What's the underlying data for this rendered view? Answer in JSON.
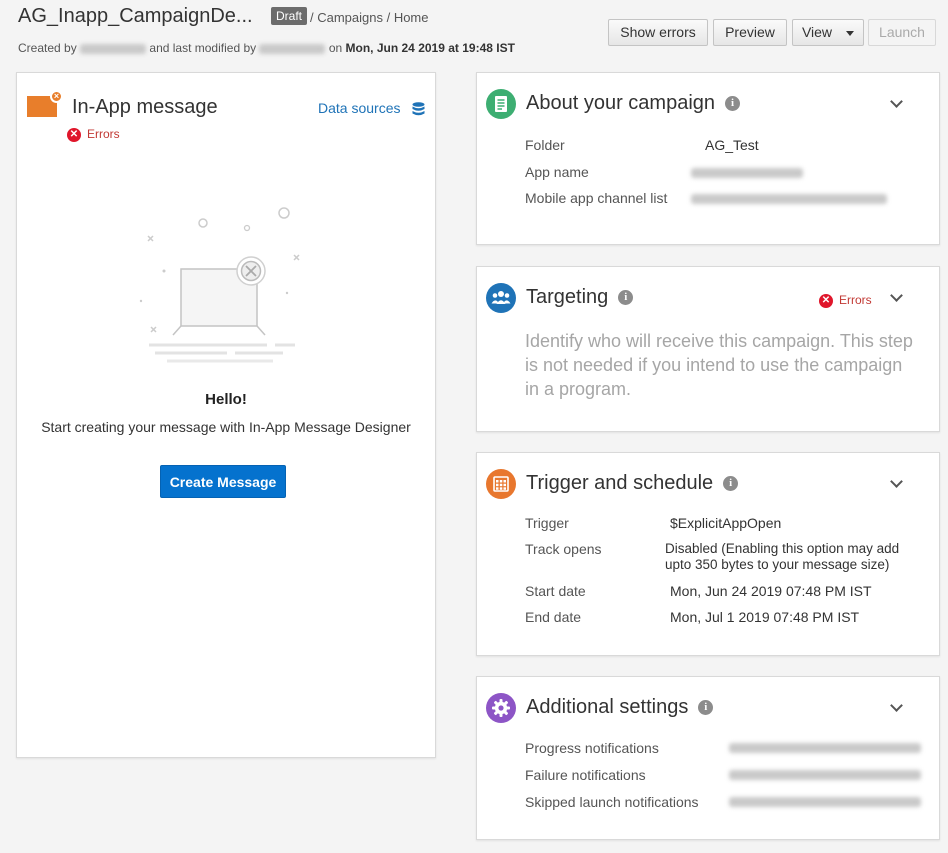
{
  "header": {
    "title": "AG_Inapp_CampaignDe...",
    "status_badge": "Draft",
    "breadcrumb": "/ Campaigns / Home",
    "created_by_label": "Created by",
    "modified_label": "and last modified by",
    "on_label": "on",
    "modified_date": "Mon, Jun 24 2019 at 19:48 IST"
  },
  "toolbar": {
    "show_errors": "Show errors",
    "preview": "Preview",
    "view": "View",
    "launch": "Launch"
  },
  "message_panel": {
    "title": "In-App message",
    "data_sources": "Data sources",
    "errors": "Errors",
    "hello": "Hello!",
    "subtitle": "Start creating your message with In-App Message Designer",
    "create_button": "Create Message"
  },
  "about": {
    "title": "About your campaign",
    "folder_label": "Folder",
    "folder_value": "AG_Test",
    "app_name_label": "App name",
    "channel_label": "Mobile app channel list"
  },
  "targeting": {
    "title": "Targeting",
    "errors": "Errors",
    "description": "Identify who will receive this campaign. This step is not needed if you intend to use the campaign in a program."
  },
  "trigger": {
    "title": "Trigger and schedule",
    "trigger_label": "Trigger",
    "trigger_value": "$ExplicitAppOpen",
    "track_label": "Track opens",
    "track_value": "Disabled (Enabling this option may add upto 350 bytes to your message size)",
    "start_label": "Start date",
    "start_value": "Mon, Jun 24 2019 07:48 PM IST",
    "end_label": "End date",
    "end_value": "Mon, Jul 1 2019 07:48 PM IST"
  },
  "additional": {
    "title": "Additional settings",
    "progress_label": "Progress notifications",
    "failure_label": "Failure notifications",
    "skipped_label": "Skipped launch notifications"
  },
  "colors": {
    "accent_blue": "#0572ce",
    "error_red": "#e0162b",
    "about_green": "#3dae72",
    "targeting_blue": "#1f73b7",
    "trigger_orange": "#e8772e",
    "settings_purple": "#8d55c6"
  },
  "icons": {
    "message": "envelope-icon",
    "data_sources": "database-icon",
    "about": "document-icon",
    "targeting": "users-icon",
    "trigger": "calendar-icon",
    "settings": "gear-icon",
    "info": "info-icon",
    "expand": "chevron-down-icon"
  }
}
